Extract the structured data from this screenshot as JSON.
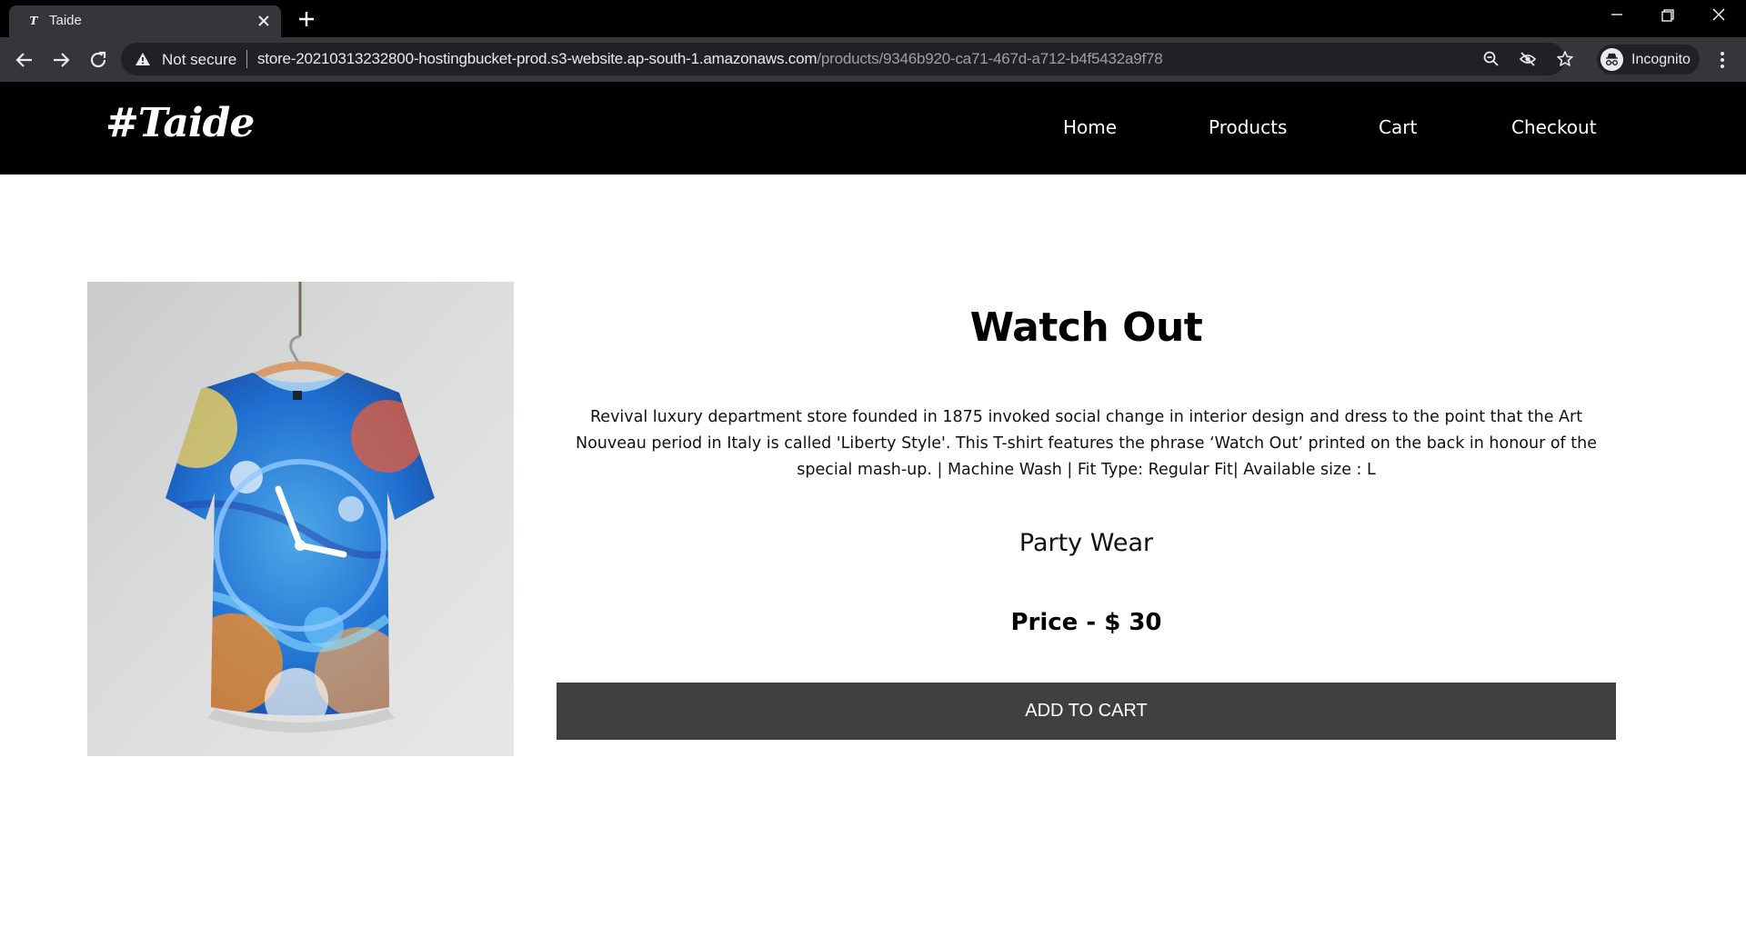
{
  "browser": {
    "tab_title": "Taide",
    "security_label": "Not secure",
    "url_host": "store-20210313232800-hostingbucket-prod.s3-website.ap-south-1.amazonaws.com",
    "url_path": "/products/9346b920-ca71-467d-a712-b4f5432a9f78",
    "profile_label": "Incognito"
  },
  "site": {
    "logo": "#Taide",
    "nav": [
      "Home",
      "Products",
      "Cart",
      "Checkout"
    ]
  },
  "product": {
    "title": "Watch Out",
    "description": "Revival luxury department store founded in 1875 invoked social change in interior design and dress to the point that the Art Nouveau period in Italy is called 'Liberty Style'. This T-shirt features the phrase ‘Watch Out’ printed on the back in honour of the special mash-up. | Machine Wash | Fit Type: Regular Fit| Available size : L",
    "category": "Party Wear",
    "price": "Price - $ 30",
    "add_to_cart_label": "ADD TO CART"
  },
  "colors": {
    "header_bg": "#000000",
    "button_bg": "#404040",
    "browser_toolbar": "#35363a"
  }
}
